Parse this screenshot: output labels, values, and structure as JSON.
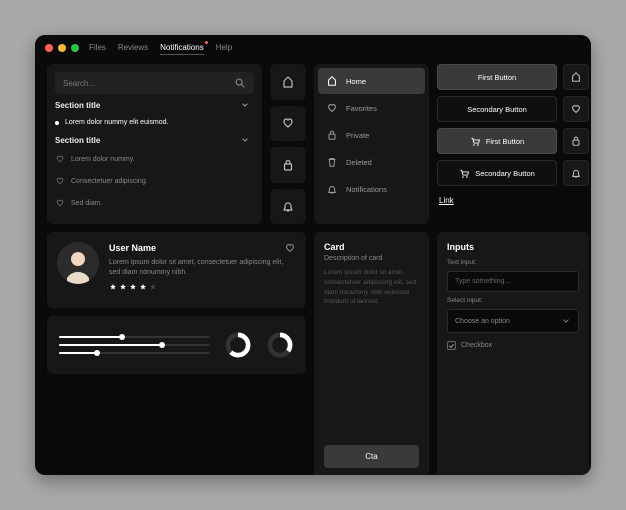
{
  "menu": {
    "files": "Files",
    "reviews": "Reviews",
    "notifications": "Notifications",
    "help": "Help"
  },
  "search": {
    "placeholder": "Search..."
  },
  "sections": {
    "a": {
      "title": "Section title",
      "item1": "Lorem dolor nummy elit euismod."
    },
    "b": {
      "title": "Section title",
      "item1": "Lorem dolor nummy.",
      "item2": "Consectetuer adipiscing.",
      "item3": "Sed diam."
    }
  },
  "nav": {
    "home": "Home",
    "favorites": "Favorites",
    "private": "Private",
    "deleted": "Deleted",
    "notifications": "Notifications"
  },
  "buttons": {
    "first": "First Button",
    "secondary": "Secondary Button",
    "first_cart": "First Button",
    "secondary_cart": "Secondary Button",
    "link": "Link"
  },
  "user": {
    "name": "User Name",
    "desc": "Lorem ipsum dolor sit amet, consectetuer adipiscing elit, sed diam nonummy nibh.",
    "rating": 4
  },
  "stats": {
    "slider1": 42,
    "slider2": 68,
    "slider3": 25,
    "donut1": 62,
    "donut2": 35
  },
  "card": {
    "title": "Card",
    "subtitle": "Description of card",
    "body": "Lorem ipsum dolor sit amet, consectetuer adipiscing elit, sed diam nonummy nibh euismod tincidunt ut laoreet.",
    "cta": "Cta"
  },
  "inputs": {
    "header": "Inputs",
    "text_label": "Text input:",
    "text_placeholder": "Type something...",
    "select_label": "Select input:",
    "select_placeholder": "Choose an option",
    "checkbox_label": "Checkbox"
  }
}
